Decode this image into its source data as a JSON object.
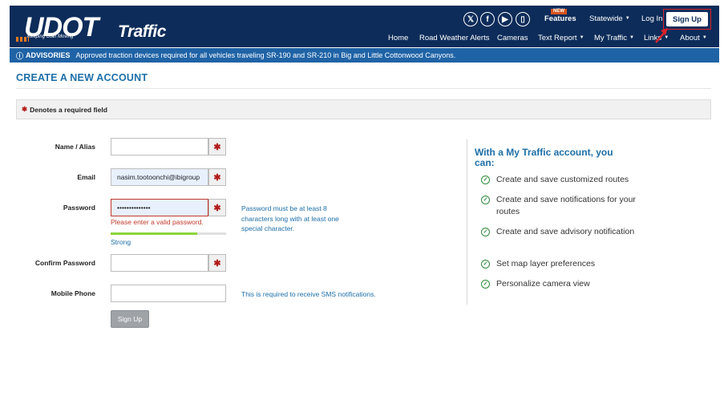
{
  "header": {
    "logo_text": "UDOT",
    "logo_tagline": "Keeping Utah Moving",
    "logo_suffix": "Traffic",
    "social_icons": [
      "x-icon",
      "facebook-icon",
      "youtube-icon",
      "app-icon"
    ],
    "new_badge": "NEW",
    "top_links": {
      "features": "Features",
      "statewide": "Statewide",
      "login": "Log In",
      "signup": "Sign Up"
    },
    "nav": [
      "Home",
      "Road Weather Alerts",
      "Cameras",
      "Text Report",
      "My Traffic",
      "Links",
      "About"
    ]
  },
  "advisory": {
    "label": "ADVISORIES",
    "text": "Approved traction devices required for all vehicles traveling SR-190 and SR-210 in Big and Little Cottonwood Canyons."
  },
  "page": {
    "title": "CREATE A NEW ACCOUNT",
    "required_note": "Denotes a required field"
  },
  "form": {
    "name_label": "Name / Alias",
    "name_value": "",
    "email_label": "Email",
    "email_value": "nasim.tootoonchi@ibigroup",
    "password_label": "Password",
    "password_value": "••••••••••••••",
    "password_error": "Please enter a valid password.",
    "password_help": "Password must be at least 8 characters long with at least one special character.",
    "password_strength_label": "Strong",
    "password_strength_fraction": 0.75,
    "confirm_label": "Confirm Password",
    "confirm_value": "",
    "phone_label": "Mobile Phone",
    "phone_value": "",
    "phone_help": "This is required to receive SMS notifications.",
    "submit_label": "Sign Up"
  },
  "benefits": {
    "title": "With a My Traffic account, you can:",
    "items": [
      "Create and save customized routes",
      "Create and save notifications for your routes",
      "Create and save advisory notification",
      "Set map layer preferences",
      "Personalize camera view"
    ]
  },
  "colors": {
    "header_bg": "#0d2c5a",
    "advisory_bg": "#1f63a6",
    "accent": "#1d6fa8",
    "required": "#b21b1b",
    "error": "#c0392b",
    "strength": "#8cd33c",
    "highlight": "#d8232a"
  }
}
